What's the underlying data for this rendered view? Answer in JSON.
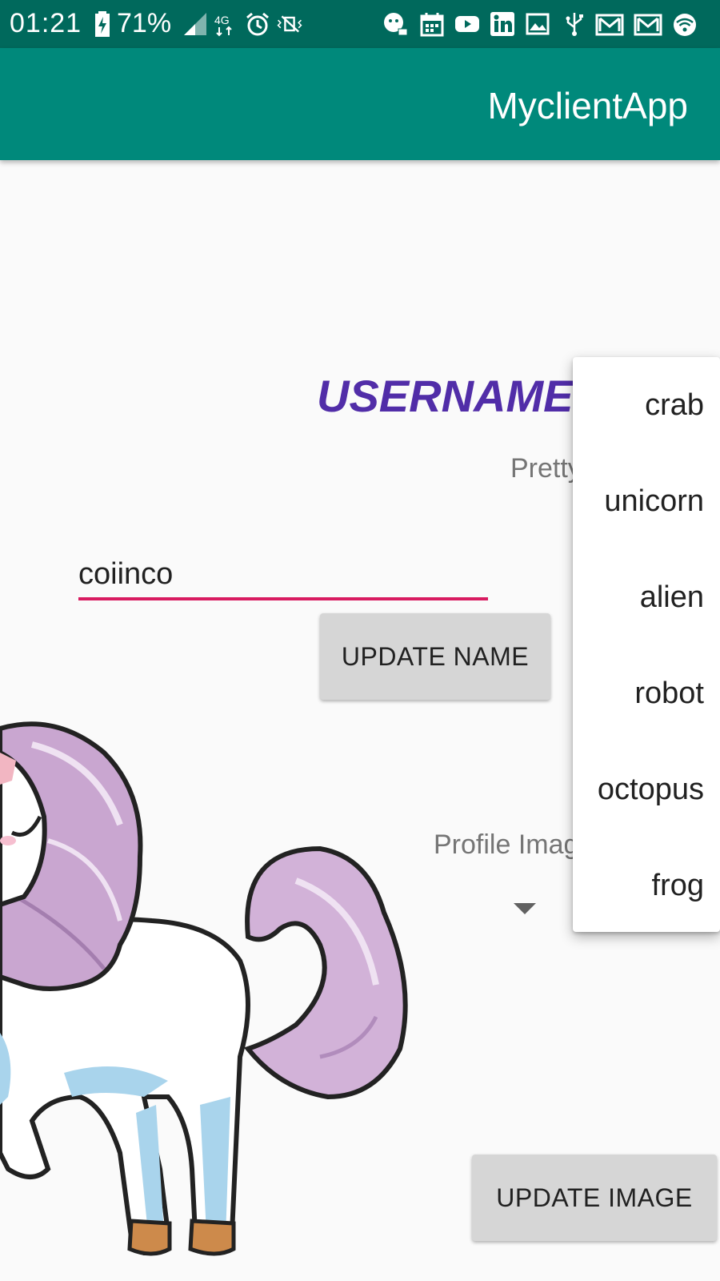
{
  "status_bar": {
    "time": "01:21",
    "battery": "71%",
    "icons": [
      "battery-charging-icon",
      "signal-icon",
      "4g-icon",
      "alarm-icon",
      "vibrate-icon",
      "chat-notification-icon",
      "calendar-icon",
      "youtube-icon",
      "linkedin-icon",
      "image-icon",
      "usb-icon",
      "gmail-icon",
      "gmail-icon",
      "wifi-icon"
    ]
  },
  "app_bar": {
    "title": "MyclientApp"
  },
  "main": {
    "username_title": "USERNAME",
    "subtitle": "Pretty",
    "name_input_value": "coiinco",
    "update_name_button": "UPDATE NAME",
    "profile_image_label": "Profile Imag",
    "update_image_button": "UPDATE IMAGE",
    "selected_image": "unicorn"
  },
  "dropdown": {
    "items": [
      "crab",
      "unicorn",
      "alien",
      "robot",
      "octopus",
      "frog"
    ]
  },
  "colors": {
    "status_bar": "#00695c",
    "app_bar": "#00897b",
    "title_accent": "#512da8",
    "input_underline": "#d81b60",
    "button_bg": "#d6d6d6"
  }
}
